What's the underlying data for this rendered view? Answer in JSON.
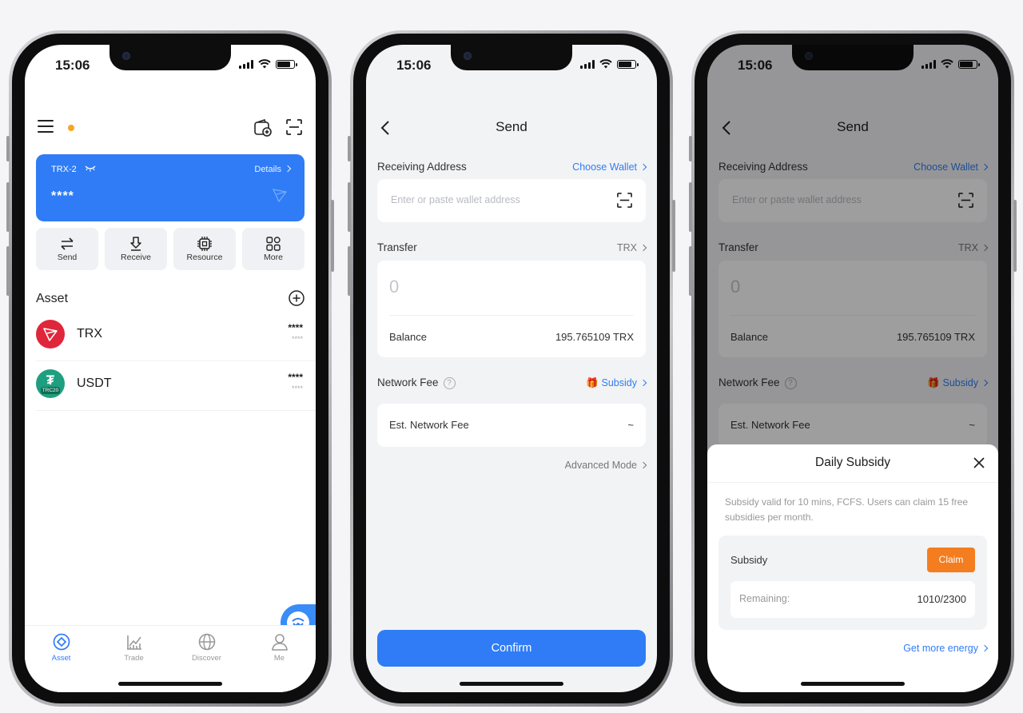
{
  "status_time": "15:06",
  "home": {
    "wallet_name": "TRX-2",
    "details_label": "Details",
    "balance_masked": "****",
    "actions": [
      {
        "label": "Send",
        "icon": "swap-arrows-icon"
      },
      {
        "label": "Receive",
        "icon": "download-icon"
      },
      {
        "label": "Resource",
        "icon": "chip-icon"
      },
      {
        "label": "More",
        "icon": "grid-icon"
      }
    ],
    "asset_title": "Asset",
    "assets": [
      {
        "name": "TRX",
        "masked_amount": "****",
        "masked_value": "****",
        "color": "#e0263a"
      },
      {
        "name": "USDT",
        "masked_amount": "****",
        "masked_value": "****",
        "badge": "TRC20",
        "color": "#1e9f7f"
      }
    ],
    "tabs": [
      {
        "label": "Asset",
        "icon": "asset-icon",
        "active": true
      },
      {
        "label": "Trade",
        "icon": "chart-icon",
        "active": false
      },
      {
        "label": "Discover",
        "icon": "globe-icon",
        "active": false
      },
      {
        "label": "Me",
        "icon": "person-icon",
        "active": false
      }
    ]
  },
  "send": {
    "title": "Send",
    "receiving_label": "Receiving Address",
    "choose_wallet": "Choose Wallet",
    "address_placeholder": "Enter or paste wallet address",
    "transfer_label": "Transfer",
    "token": "TRX",
    "amount": "0",
    "balance_label": "Balance",
    "balance_value": "195.765109 TRX",
    "fee_label": "Network Fee",
    "subsidy_link": "Subsidy",
    "est_fee_label": "Est. Network Fee",
    "est_fee_value": "~",
    "advanced_mode": "Advanced Mode",
    "confirm": "Confirm"
  },
  "subsidy_sheet": {
    "title": "Daily Subsidy",
    "description": "Subsidy valid for 10 mins, FCFS. Users can claim 15 free subsidies per month.",
    "subsidy_label": "Subsidy",
    "claim": "Claim",
    "remaining_label": "Remaining:",
    "remaining_value": "1010/2300",
    "get_more": "Get more energy"
  },
  "colors": {
    "accent": "#2f7cf6",
    "claim": "#f47d20",
    "dot": "#f5a623"
  }
}
